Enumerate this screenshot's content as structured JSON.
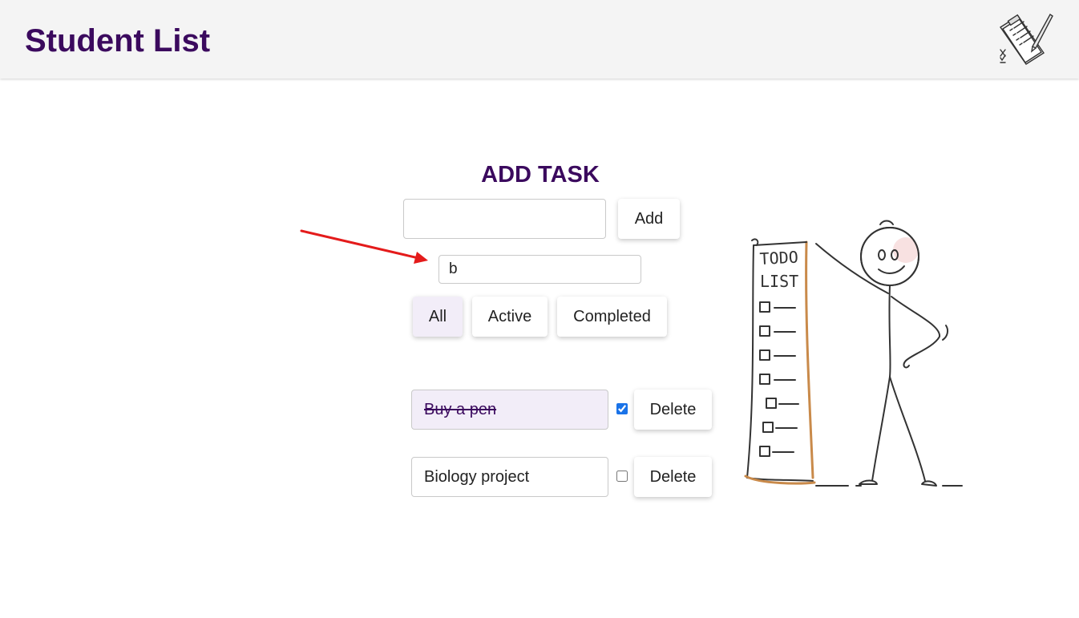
{
  "header": {
    "title": "Student List",
    "logo_icon": "clipboard-checklist-icon"
  },
  "add_task": {
    "title": "ADD TASK",
    "input_value": "",
    "add_label": "Add"
  },
  "search": {
    "value": "b"
  },
  "filters": [
    {
      "label": "All",
      "active": true
    },
    {
      "label": "Active",
      "active": false
    },
    {
      "label": "Completed",
      "active": false
    }
  ],
  "tasks": [
    {
      "text": "Buy a pen",
      "completed": true,
      "delete_label": "Delete"
    },
    {
      "text": "Biology project",
      "completed": false,
      "delete_label": "Delete"
    }
  ],
  "illustration": {
    "icon": "stick-figure-todo-list-icon",
    "scroll_text_line1": "TODO",
    "scroll_text_line2": "LIST"
  },
  "annotation": {
    "icon": "red-arrow-icon",
    "color": "#e41b1b"
  },
  "colors": {
    "brand": "#3b0a5e",
    "selected_bg": "#f2edf8",
    "header_bg": "#f4f4f4"
  }
}
